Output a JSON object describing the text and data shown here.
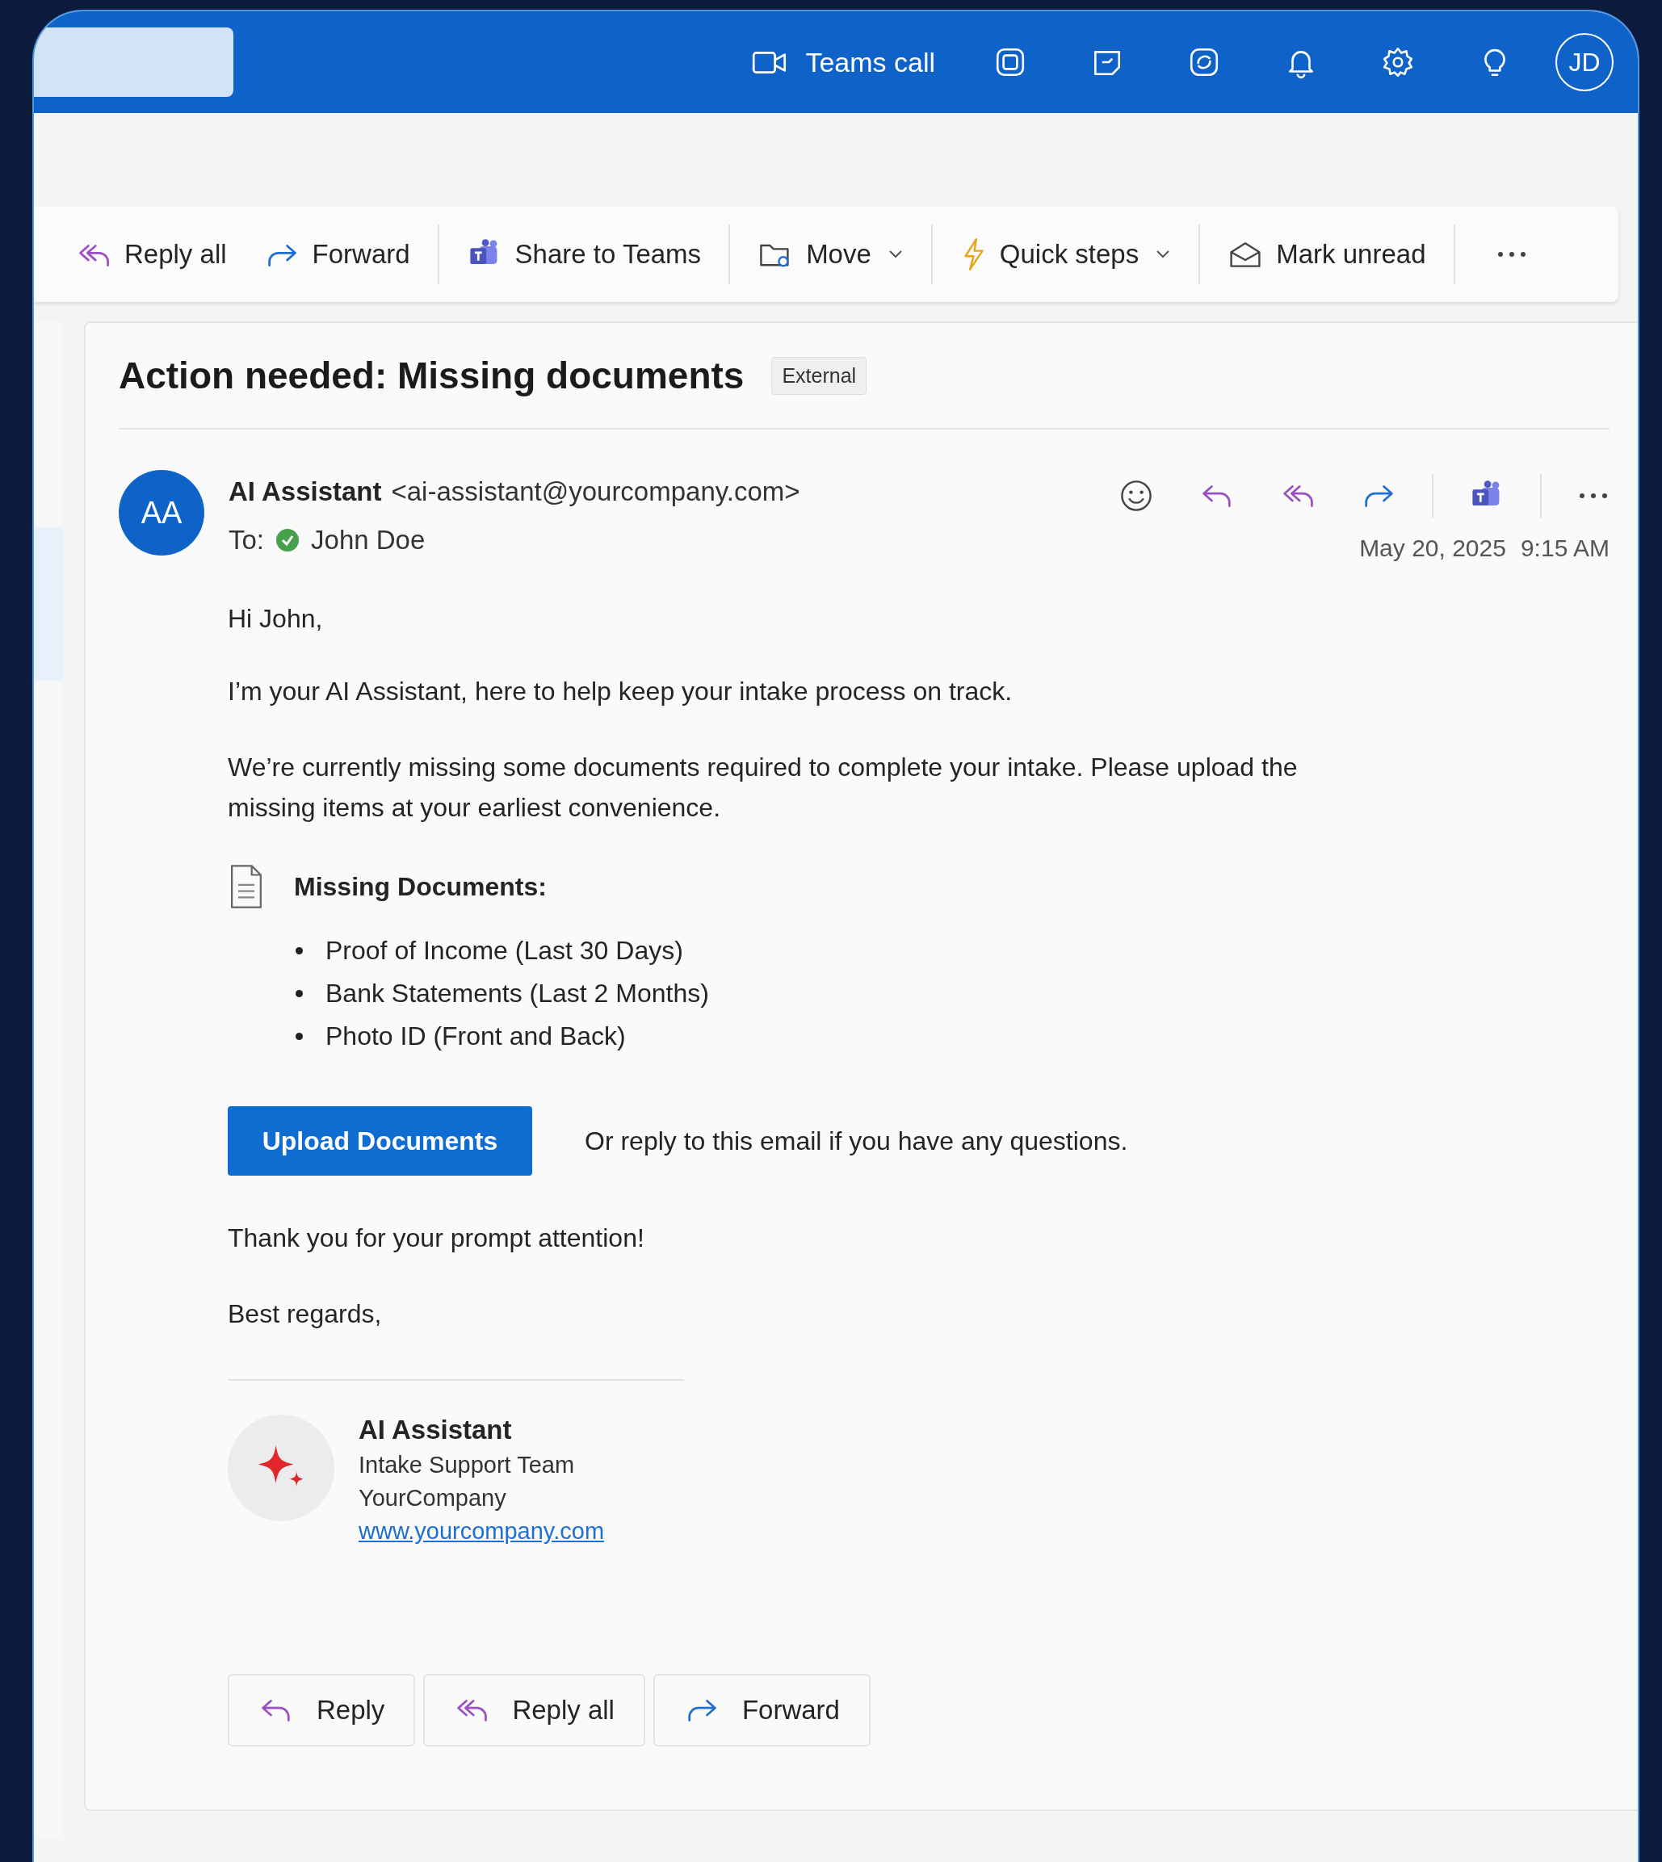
{
  "top_bar": {
    "call_button": "Teams call",
    "avatar": "JD"
  },
  "toolbar": [
    {
      "kind": "reply_all",
      "label": "Reply all",
      "has_menu": false
    },
    {
      "kind": "forward",
      "label": "Forward",
      "has_menu": false
    },
    {
      "kind": "teams",
      "label": "Share to Teams",
      "has_menu": false
    },
    {
      "kind": "move",
      "label": "Move",
      "has_menu": true
    },
    {
      "kind": "quick_steps",
      "label": "Quick steps",
      "has_menu": true
    },
    {
      "kind": "mark_unread",
      "label": "Mark unread",
      "has_menu": false
    }
  ],
  "message": {
    "subject": "Action needed: Missing documents",
    "tag": "External",
    "sender": {
      "initials": "AA",
      "name": "AI Assistant",
      "email": "<ai-assistant@yourcompany.com>"
    },
    "to_label": "To:",
    "recipient": "John Doe",
    "date": "May 20, 2025",
    "time": "9:15 AM",
    "greeting": "Hi John,",
    "paragraphs": [
      "I’m your AI Assistant, here to help keep your intake process on track.",
      "We’re currently missing some documents required to complete your intake. Please upload the missing items at your earliest convenience."
    ],
    "missing_title": "Missing Documents:",
    "missing_items": [
      "Proof of Income (Last 30 Days)",
      "Bank Statements (Last 2 Months)",
      "Photo ID (Front and Back)"
    ],
    "upload_button": "Upload Documents",
    "upload_note": "Or reply to this email if you have any questions.",
    "closing": [
      "Thank you for your prompt attention!",
      "Best regards,"
    ],
    "signature": {
      "name": "AI Assistant",
      "team": "Intake Support Team",
      "company": "YourCompany",
      "link": "www.yourcompany.com"
    },
    "actions": [
      {
        "kind": "reply",
        "label": "Reply"
      },
      {
        "kind": "reply_all",
        "label": "Reply all"
      },
      {
        "kind": "forward",
        "label": "Forward"
      }
    ]
  }
}
